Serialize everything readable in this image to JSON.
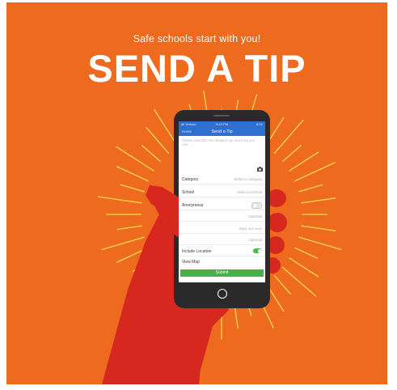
{
  "poster": {
    "tagline": "Safe schools start with you!",
    "headline": "SEND A TIP",
    "background_color": "#ee6a1f",
    "ray_color": "#f7c648",
    "hand_color": "#d6281f"
  },
  "phone": {
    "status_bar": {
      "carrier": "all Verizon",
      "time": "9:43 PM",
      "battery": "87%"
    },
    "nav": {
      "back_label": "Home",
      "title": "Send a Tip"
    },
    "tip_placeholder": "Please describe the situation as much as you can...",
    "camera_icon": "camera-icon",
    "rows": [
      {
        "label": "Category",
        "value": "Select a category"
      },
      {
        "label": "School",
        "value": "Select a school"
      },
      {
        "label": "Anonymous",
        "value": ""
      },
      {
        "label": "",
        "value": "Optional"
      },
      {
        "label": "",
        "value": "(xxx) xxx-xxxx"
      },
      {
        "label": "",
        "value": "Optional"
      }
    ],
    "toggles": [
      {
        "label": "Include Location",
        "state": "on"
      },
      {
        "label": "View Map",
        "state": ""
      }
    ],
    "submit_label": "Submit",
    "accent_color": "#2f6fd0",
    "toggle_on_color": "#4cbb47",
    "submit_color": "#4cae4c"
  }
}
